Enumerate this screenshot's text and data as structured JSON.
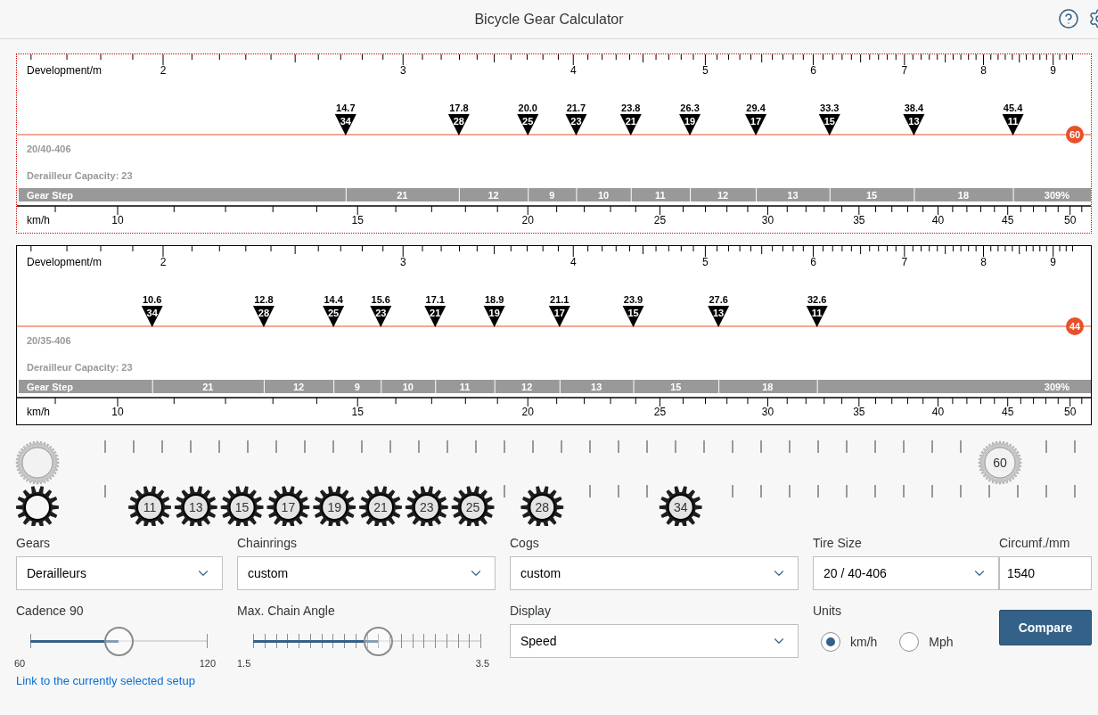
{
  "header": {
    "title": "Bicycle Gear Calculator"
  },
  "charts": [
    {
      "selected": true,
      "development_label": "Development/m",
      "development_ticks": [
        "2",
        "3",
        "4",
        "5",
        "6",
        "7",
        "8",
        "9"
      ],
      "speed_label": "km/h",
      "speed_ticks": [
        "10",
        "15",
        "20",
        "25",
        "30",
        "35",
        "40",
        "45",
        "50"
      ],
      "tire": "20/40-406",
      "capacity": "Derailleur Capacity: 23",
      "gear_step_label": "Gear Step",
      "steps": [
        "21",
        "12",
        "9",
        "10",
        "11",
        "12",
        "13",
        "15",
        "18"
      ],
      "total_range": "309%",
      "chainring": "60",
      "gears": [
        {
          "speed": "14.7",
          "cog": "34"
        },
        {
          "speed": "17.8",
          "cog": "28"
        },
        {
          "speed": "20.0",
          "cog": "25"
        },
        {
          "speed": "21.7",
          "cog": "23"
        },
        {
          "speed": "23.8",
          "cog": "21"
        },
        {
          "speed": "26.3",
          "cog": "19"
        },
        {
          "speed": "29.4",
          "cog": "17"
        },
        {
          "speed": "33.3",
          "cog": "15"
        },
        {
          "speed": "38.4",
          "cog": "13"
        },
        {
          "speed": "45.4",
          "cog": "11"
        }
      ]
    },
    {
      "selected": false,
      "development_label": "Development/m",
      "development_ticks": [
        "2",
        "3",
        "4",
        "5",
        "6",
        "7",
        "8",
        "9"
      ],
      "speed_label": "km/h",
      "speed_ticks": [
        "10",
        "15",
        "20",
        "25",
        "30",
        "35",
        "40",
        "45",
        "50"
      ],
      "tire": "20/35-406",
      "capacity": "Derailleur Capacity: 23",
      "gear_step_label": "Gear Step",
      "steps": [
        "21",
        "12",
        "9",
        "10",
        "11",
        "12",
        "13",
        "15",
        "18"
      ],
      "total_range": "309%",
      "chainring": "44",
      "gears": [
        {
          "speed": "10.6",
          "cog": "34"
        },
        {
          "speed": "12.8",
          "cog": "28"
        },
        {
          "speed": "14.4",
          "cog": "25"
        },
        {
          "speed": "15.6",
          "cog": "23"
        },
        {
          "speed": "17.1",
          "cog": "21"
        },
        {
          "speed": "18.9",
          "cog": "19"
        },
        {
          "speed": "21.1",
          "cog": "17"
        },
        {
          "speed": "23.9",
          "cog": "15"
        },
        {
          "speed": "27.6",
          "cog": "13"
        },
        {
          "speed": "32.6",
          "cog": "11"
        }
      ]
    }
  ],
  "drivetrain": {
    "chainrings": [
      "60"
    ],
    "cogs": [
      "11",
      "13",
      "15",
      "17",
      "19",
      "21",
      "23",
      "25",
      "28",
      "34"
    ]
  },
  "form": {
    "gears": {
      "label": "Gears",
      "value": "Derailleurs"
    },
    "chainrings": {
      "label": "Chainrings",
      "value": "custom"
    },
    "cogs": {
      "label": "Cogs",
      "value": "custom"
    },
    "tire_size": {
      "label": "Tire Size",
      "value": "20 / 40-406"
    },
    "circumference": {
      "label": "Circumf./mm",
      "value": "1540"
    },
    "cadence": {
      "label": "Cadence 90",
      "level": 0.5,
      "min": "60",
      "max": "120"
    },
    "chain_angle": {
      "label": "Max. Chain Angle",
      "level": 0.55,
      "min": "1.5",
      "max": "3.5"
    },
    "display": {
      "label": "Display",
      "value": "Speed"
    },
    "units": {
      "label": "Units",
      "options": [
        {
          "label": "km/h",
          "selected": true
        },
        {
          "label": "Mph",
          "selected": false
        }
      ]
    },
    "compare_button": "Compare",
    "link": "Link to the currently selected setup"
  }
}
